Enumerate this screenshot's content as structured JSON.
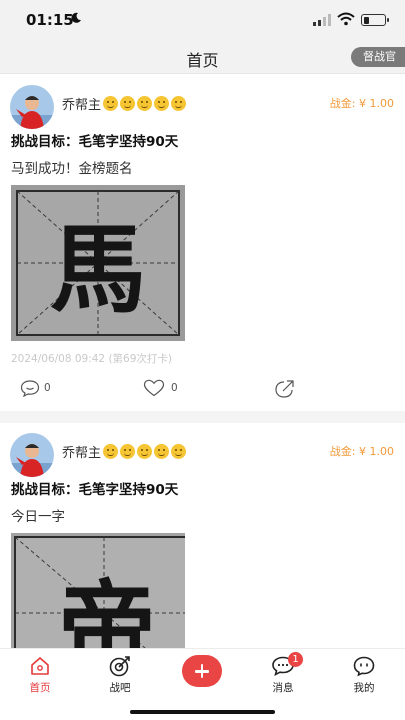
{
  "status_bar": {
    "time": "01:15"
  },
  "nav": {
    "title": "首页",
    "supervisor_label": "督战官"
  },
  "posts": [
    {
      "username": "乔帮主",
      "war_fund": "战金: ¥ 1.00",
      "goal": "挑战目标：毛笔字坚持90天",
      "text": "马到成功！金榜题名",
      "photo_char": "馬",
      "meta": "2024/06/08 09:42 (第69次打卡)",
      "comments": "0",
      "likes": "0"
    },
    {
      "username": "乔帮主",
      "war_fund": "战金: ¥ 1.00",
      "goal": "挑战目标：毛笔字坚持90天",
      "text": "今日一字",
      "photo_char": "帝"
    }
  ],
  "tabbar": {
    "items": [
      {
        "label": "首页",
        "icon": "home-icon"
      },
      {
        "label": "战吧",
        "icon": "target-icon"
      },
      {
        "label": "",
        "icon": "plus-icon"
      },
      {
        "label": "消息",
        "icon": "message-icon",
        "badge": "1"
      },
      {
        "label": "我的",
        "icon": "profile-icon"
      }
    ]
  },
  "colors": {
    "accent": "#e94545",
    "fund": "#f29a3a",
    "meta": "#c9c9c9"
  }
}
